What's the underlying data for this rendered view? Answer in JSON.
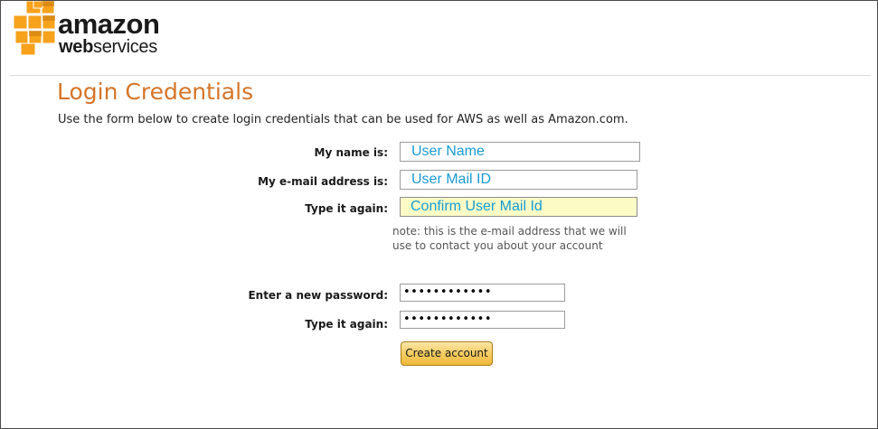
{
  "brand": {
    "name": "amazon",
    "sub_web": "web",
    "sub_services": "services",
    "logo_color": "#f7a21b",
    "icon": "aws-cubes-icon"
  },
  "page": {
    "title": "Login Credentials",
    "intro": "Use the form below to create login credentials that can be used for AWS as well as Amazon.com.",
    "title_color": "#d5752a"
  },
  "form": {
    "name_label": "My name is:",
    "name_value": "User Name",
    "email_label": "My e-mail address is:",
    "email_value": "User Mail ID",
    "email_confirm_label": "Type it again:",
    "email_confirm_value": "Confirm User Mail Id",
    "note": "note: this is the e-mail address that we will use to contact you about your account",
    "password_label": "Enter a new password:",
    "password_value": "••••••••••••",
    "password_confirm_label": "Type it again:",
    "password_confirm_value": "••••••••••••",
    "submit_label": "Create account",
    "field_text_color": "#1a9bd1",
    "highlight_color": "#fbfbc6"
  }
}
